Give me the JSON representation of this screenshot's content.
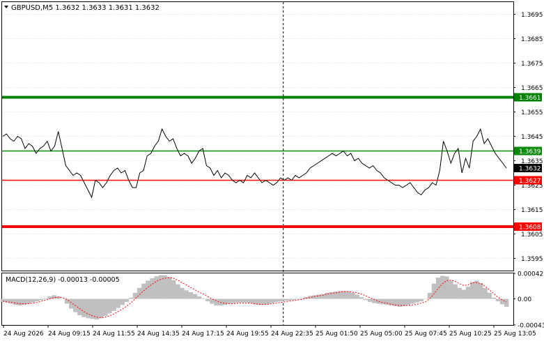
{
  "window": {
    "symbol_header": "GBPUSD,M5  1.3632 1.3633 1.3631 1.3632",
    "menu_glyph": "triangle-down-icon"
  },
  "colors": {
    "price_line": "#000000",
    "grid": "#c0c0c0",
    "green_thick": "#008000",
    "green_thin": "#0a8a0a",
    "red": "#ff0000",
    "macd_hist": "#c0c0c0",
    "macd_signal": "#ff0000",
    "current_price_bg": "#000000"
  },
  "chart_data": [
    {
      "type": "line",
      "title": "GBPUSD,M5  1.3632 1.3633 1.3631 1.3632",
      "ylim": [
        1.359,
        1.37
      ],
      "y_ticks": [
        "1.3695",
        "1.3685",
        "1.3675",
        "1.3665",
        "1.3655",
        "1.3645",
        "1.3635",
        "1.3625",
        "1.3615",
        "1.3605",
        "1.3595"
      ],
      "x_ticks": [
        "24 Aug 2026",
        "24 Aug 09:15",
        "24 Aug 11:55",
        "24 Aug 14:35",
        "24 Aug 17:15",
        "24 Aug 19:55",
        "24 Aug 22:35",
        "25 Aug 01:50",
        "25 Aug 05:00",
        "25 Aug 07:45",
        "25 Aug 10:25",
        "25 Aug 13:05"
      ],
      "horizontal_levels": [
        {
          "value": 1.3661,
          "label": "1.3661",
          "color": "#008000",
          "style": "thick"
        },
        {
          "value": 1.3639,
          "label": "1.3639",
          "color": "#0a8a0a",
          "style": "thin"
        },
        {
          "value": 1.3627,
          "label": "1.3627",
          "color": "#ff0000",
          "style": "thin"
        },
        {
          "value": 1.3608,
          "label": "1.3608",
          "color": "#ff0000",
          "style": "thick"
        }
      ],
      "current_price": {
        "value": 1.3632,
        "label": "1.3632"
      },
      "vertical_marker_x": 0.55,
      "series": [
        {
          "values": [
            1.3645,
            1.3646,
            1.3644,
            1.3643,
            1.3645,
            1.3644,
            1.364,
            1.3642,
            1.3641,
            1.3638,
            1.364,
            1.3641,
            1.3643,
            1.3639,
            1.3641,
            1.3647,
            1.364,
            1.3633,
            1.3631,
            1.3629,
            1.363,
            1.3629,
            1.3626,
            1.3623,
            1.362,
            1.3627,
            1.3626,
            1.3624,
            1.3626,
            1.3629,
            1.3631,
            1.3632,
            1.363,
            1.3631,
            1.3627,
            1.3624,
            1.3624,
            1.363,
            1.3631,
            1.3637,
            1.3638,
            1.3641,
            1.3643,
            1.3648,
            1.3645,
            1.3643,
            1.3644,
            1.364,
            1.3637,
            1.3638,
            1.3637,
            1.3634,
            1.3636,
            1.3639,
            1.364,
            1.3633,
            1.3632,
            1.3629,
            1.3631,
            1.3628,
            1.363,
            1.3629,
            1.3627,
            1.3626,
            1.3627,
            1.3626,
            1.3629,
            1.3628,
            1.363,
            1.3628,
            1.3626,
            1.3627,
            1.3626,
            1.3625,
            1.3626,
            1.3628,
            1.3627,
            1.3628,
            1.3627,
            1.3629,
            1.3628,
            1.3629,
            1.363,
            1.3632,
            1.3633,
            1.3634,
            1.3635,
            1.3636,
            1.3637,
            1.3638,
            1.3637,
            1.3638,
            1.3639,
            1.3637,
            1.3638,
            1.3635,
            1.3636,
            1.3634,
            1.3633,
            1.3632,
            1.3633,
            1.3631,
            1.363,
            1.3628,
            1.3627,
            1.3626,
            1.3625,
            1.3625,
            1.3624,
            1.3625,
            1.3626,
            1.3624,
            1.3622,
            1.3621,
            1.3623,
            1.3624,
            1.3626,
            1.3625,
            1.3631,
            1.3643,
            1.3639,
            1.3634,
            1.3638,
            1.364,
            1.363,
            1.3636,
            1.3632,
            1.3643,
            1.3645,
            1.3648,
            1.3642,
            1.3644,
            1.3641,
            1.3638,
            1.3636,
            1.3634,
            1.3632
          ]
        }
      ],
      "macd": {
        "label": "MACD(12,26,9) -0.00013 -0.00005",
        "ylim": [
          -0.00043,
          0.00042
        ],
        "y_ticks": [
          "0.00042",
          "0.00",
          "-0.00043"
        ],
        "histogram": [
          -5e-05,
          -6e-05,
          -8e-05,
          -0.0001,
          -0.00011,
          -0.0001,
          -8e-05,
          -6e-05,
          -4e-05,
          -2e-05,
          1e-05,
          4e-05,
          6e-05,
          4e-05,
          0.0,
          -8e-05,
          -0.00016,
          -0.00022,
          -0.00027,
          -0.0003,
          -0.00032,
          -0.00033,
          -0.00034,
          -0.00032,
          -0.00028,
          -0.00024,
          -0.0002,
          -0.00015,
          -0.0001,
          -5e-05,
          2e-05,
          0.0001,
          0.00018,
          0.00025,
          0.0003,
          0.00034,
          0.00037,
          0.00039,
          0.00039,
          0.00036,
          0.00031,
          0.00024,
          0.00018,
          0.00014,
          0.00011,
          8e-05,
          4e-05,
          1e-05,
          -4e-05,
          -8e-05,
          -0.00011,
          -0.00011,
          -0.0001,
          -8e-05,
          -7e-05,
          -6e-05,
          -6e-05,
          -6e-05,
          -7e-05,
          -9e-05,
          -0.0001,
          -0.0001,
          -9e-05,
          -7e-05,
          -5e-05,
          -4e-05,
          -3e-05,
          -3e-05,
          -2e-05,
          -1e-05,
          1e-05,
          3e-05,
          5e-05,
          6e-05,
          7e-05,
          8e-05,
          0.0001,
          0.00011,
          0.00012,
          0.00013,
          0.00013,
          0.00012,
          0.0001,
          7e-05,
          3e-05,
          -2e-05,
          -5e-05,
          -7e-05,
          -8e-05,
          -9e-05,
          -0.0001,
          -0.00011,
          -0.00012,
          -0.00013,
          -0.00012,
          -0.0001,
          -8e-05,
          -6e-05,
          -4e-05,
          0.0,
          0.0001,
          0.00025,
          0.00035,
          0.00038,
          0.00037,
          0.0003,
          0.00024,
          0.00018,
          0.00015,
          0.0002,
          0.00028,
          0.0003,
          0.00026,
          0.00018,
          0.0001,
          2e-05,
          -4e-05,
          -9e-05,
          -0.00013
        ],
        "signal": [
          -4e-05,
          -5e-05,
          -6e-05,
          -7e-05,
          -8e-05,
          -8e-05,
          -8e-05,
          -7e-05,
          -6e-05,
          -4e-05,
          -2e-05,
          0.0,
          2e-05,
          3e-05,
          2e-05,
          -1e-05,
          -6e-05,
          -0.00011,
          -0.00016,
          -0.00021,
          -0.00025,
          -0.00028,
          -0.0003,
          -0.00031,
          -0.0003,
          -0.00028,
          -0.00025,
          -0.00021,
          -0.00017,
          -0.00012,
          -7e-05,
          0.0,
          7e-05,
          0.00013,
          0.00019,
          0.00024,
          0.00029,
          0.00032,
          0.00034,
          0.00035,
          0.00034,
          0.00031,
          0.00027,
          0.00023,
          0.00019,
          0.00015,
          0.00011,
          8e-05,
          4e-05,
          0.0,
          -3e-05,
          -6e-05,
          -7e-05,
          -8e-05,
          -8e-05,
          -7e-05,
          -7e-05,
          -7e-05,
          -7e-05,
          -8e-05,
          -9e-05,
          -9e-05,
          -9e-05,
          -8e-05,
          -7e-05,
          -6e-05,
          -5e-05,
          -4e-05,
          -3e-05,
          -2e-05,
          -1e-05,
          1e-05,
          2e-05,
          4e-05,
          5e-05,
          6e-05,
          8e-05,
          9e-05,
          0.0001,
          0.00011,
          0.00012,
          0.00012,
          0.00011,
          0.0001,
          8e-05,
          5e-05,
          2e-05,
          -1e-05,
          -4e-05,
          -6e-05,
          -7e-05,
          -9e-05,
          -0.0001,
          -0.00011,
          -0.00011,
          -0.00011,
          -0.0001,
          -9e-05,
          -7e-05,
          -5e-05,
          0.0,
          8e-05,
          0.00017,
          0.00025,
          0.0003,
          0.00031,
          0.00029,
          0.00025,
          0.00022,
          0.00023,
          0.00026,
          0.00027,
          0.00025,
          0.00021,
          0.00015,
          9e-05,
          3e-05,
          -2e-05,
          -5e-05
        ]
      }
    }
  ]
}
